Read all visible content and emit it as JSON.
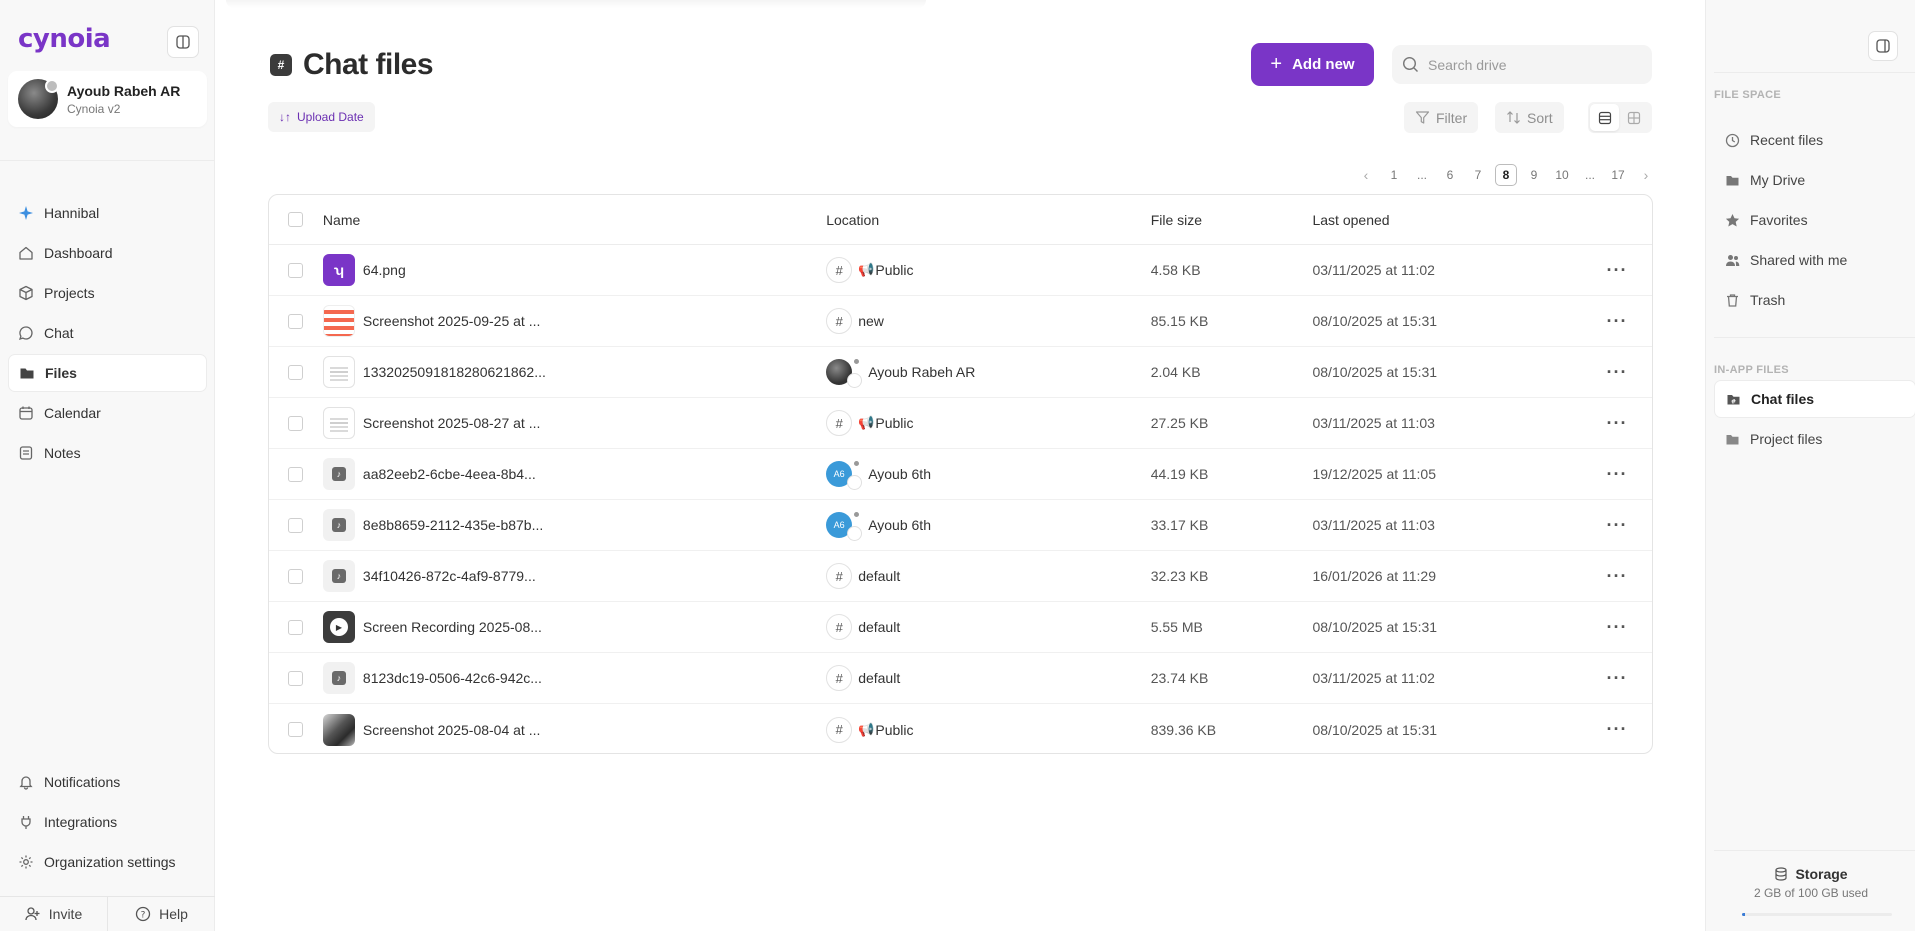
{
  "app": {
    "logo": "cynoia",
    "user": {
      "name": "Ayoub Rabeh AR",
      "subtitle": "Cynoia v2"
    }
  },
  "sidebar": {
    "items": [
      {
        "label": "Hannibal",
        "icon": "sparkle-icon"
      },
      {
        "label": "Dashboard",
        "icon": "home-icon"
      },
      {
        "label": "Projects",
        "icon": "box-icon"
      },
      {
        "label": "Chat",
        "icon": "chat-icon"
      },
      {
        "label": "Files",
        "icon": "folder-icon",
        "active": true
      },
      {
        "label": "Calendar",
        "icon": "calendar-icon"
      },
      {
        "label": "Notes",
        "icon": "notes-icon"
      }
    ],
    "footer_items": [
      {
        "label": "Notifications",
        "icon": "bell-icon"
      },
      {
        "label": "Integrations",
        "icon": "plug-icon"
      },
      {
        "label": "Organization settings",
        "icon": "gear-icon"
      }
    ],
    "invite_label": "Invite",
    "help_label": "Help"
  },
  "header": {
    "title": "Chat files",
    "add_new_label": "Add new",
    "search_placeholder": "Search drive",
    "sort_chip_label": "Upload Date",
    "filter_label": "Filter",
    "sort_label": "Sort"
  },
  "pagination": {
    "pages": [
      "1",
      "...",
      "6",
      "7",
      "8",
      "9",
      "10",
      "...",
      "17"
    ],
    "current": "8"
  },
  "table": {
    "columns": [
      "Name",
      "Location",
      "File size",
      "Last opened"
    ],
    "rows": [
      {
        "name": "64.png",
        "thumb": "purple",
        "location": "Public",
        "loc_type": "public",
        "size": "4.58 KB",
        "opened": "03/11/2025 at 11:02"
      },
      {
        "name": "Screenshot 2025-09-25 at ...",
        "thumb": "red",
        "location": "new",
        "loc_type": "hash",
        "size": "85.15 KB",
        "opened": "08/10/2025 at 15:31"
      },
      {
        "name": "1332025091818280621862...",
        "thumb": "doc",
        "location": "Ayoub Rabeh AR",
        "loc_type": "user-dark",
        "size": "2.04 KB",
        "opened": "08/10/2025 at 15:31"
      },
      {
        "name": "Screenshot 2025-08-27 at ...",
        "thumb": "doc",
        "location": "Public",
        "loc_type": "public",
        "size": "27.25 KB",
        "opened": "03/11/2025 at 11:03"
      },
      {
        "name": "aa82eeb2-6cbe-4eea-8b4...",
        "thumb": "audio",
        "location": "Ayoub 6th",
        "loc_type": "user-blue",
        "size": "44.19 KB",
        "opened": "19/12/2025 at 11:05"
      },
      {
        "name": "8e8b8659-2112-435e-b87b...",
        "thumb": "audio",
        "location": "Ayoub 6th",
        "loc_type": "user-blue",
        "size": "33.17 KB",
        "opened": "03/11/2025 at 11:03"
      },
      {
        "name": "34f10426-872c-4af9-8779...",
        "thumb": "audio",
        "location": "default",
        "loc_type": "hash",
        "size": "32.23 KB",
        "opened": "16/01/2026 at 11:29"
      },
      {
        "name": "Screen Recording 2025-08...",
        "thumb": "video",
        "location": "default",
        "loc_type": "hash",
        "size": "5.55 MB",
        "opened": "08/10/2025 at 15:31"
      },
      {
        "name": "8123dc19-0506-42c6-942c...",
        "thumb": "audio",
        "location": "default",
        "loc_type": "hash",
        "size": "23.74 KB",
        "opened": "03/11/2025 at 11:02"
      },
      {
        "name": "Screenshot 2025-08-04 at ...",
        "thumb": "photo",
        "location": "Public",
        "loc_type": "public",
        "size": "839.36 KB",
        "opened": "08/10/2025 at 15:31"
      }
    ]
  },
  "right_panel": {
    "file_space_heading": "FILE SPACE",
    "file_space_items": [
      {
        "label": "Recent files",
        "icon": "clock-icon"
      },
      {
        "label": "My Drive",
        "icon": "drive-icon"
      },
      {
        "label": "Favorites",
        "icon": "star-icon"
      },
      {
        "label": "Shared with me",
        "icon": "users-icon"
      },
      {
        "label": "Trash",
        "icon": "trash-icon"
      }
    ],
    "in_app_heading": "IN-APP FILES",
    "in_app_items": [
      {
        "label": "Chat files",
        "icon": "chat-folder-icon",
        "active": true
      },
      {
        "label": "Project files",
        "icon": "project-folder-icon"
      }
    ],
    "storage": {
      "title": "Storage",
      "usage": "2 GB of 100 GB used",
      "fraction": 0.02
    }
  },
  "colors": {
    "accent": "#7a35c7",
    "storage_bar": "#3a7bd5"
  }
}
